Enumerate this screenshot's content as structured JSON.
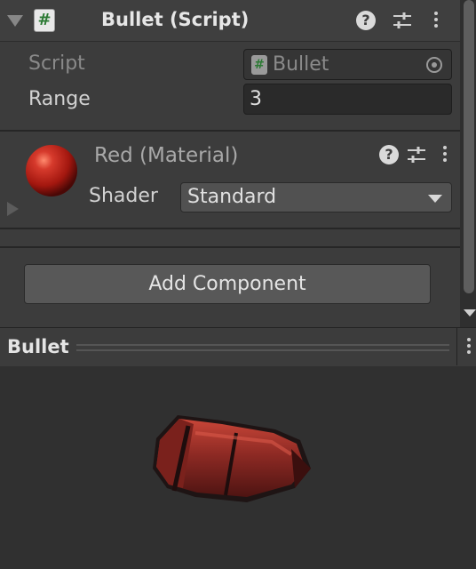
{
  "component": {
    "title": "Bullet (Script)",
    "script_label": "Script",
    "script_value": "Bullet",
    "range_label": "Range",
    "range_value": "3"
  },
  "material": {
    "title": "Red (Material)",
    "shader_label": "Shader",
    "shader_value": "Standard",
    "sphere_color": "#c0221c"
  },
  "add_component_label": "Add Component",
  "preview": {
    "title": "Bullet",
    "bullet_color": "#8e2a24"
  },
  "icons": {
    "script": "#"
  }
}
